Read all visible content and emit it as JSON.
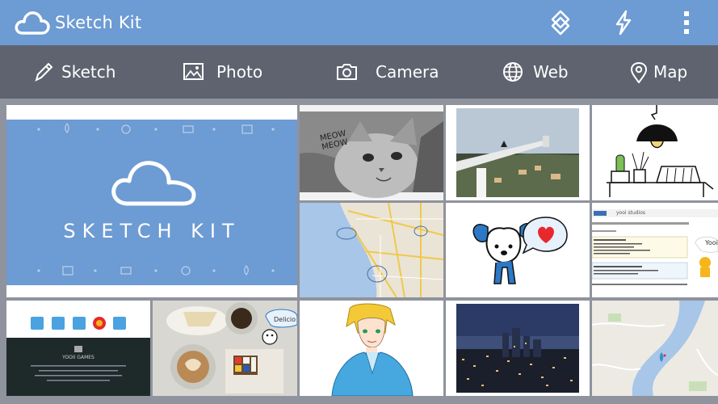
{
  "app": {
    "title": "Sketch Kit"
  },
  "toolbar": {
    "actions": [
      {
        "icon": "layers-icon"
      },
      {
        "icon": "lightning-icon"
      },
      {
        "icon": "more-vert-icon"
      }
    ]
  },
  "tabs": [
    {
      "label": "Sketch",
      "icon": "pencil-icon"
    },
    {
      "label": "Photo",
      "icon": "image-icon"
    },
    {
      "label": "Camera",
      "icon": "camera-icon"
    },
    {
      "label": "Web",
      "icon": "globe-icon"
    },
    {
      "label": "Map",
      "icon": "map-pin-icon"
    }
  ],
  "gallery": {
    "banner": {
      "text": "SKETCH KIT"
    },
    "cat": {
      "caption": "MEOW MEOW"
    },
    "food": {
      "bubble": "Delicio"
    },
    "website": {
      "header": "yooi studios",
      "bubble": "Yooi"
    },
    "games": {
      "title": "YOOII GAMES"
    }
  },
  "colors": {
    "app_bar": "#6d9bd3",
    "tab_bar": "#5f636f",
    "banner_blue": "#6d9bd3",
    "background": "#8f939d"
  }
}
